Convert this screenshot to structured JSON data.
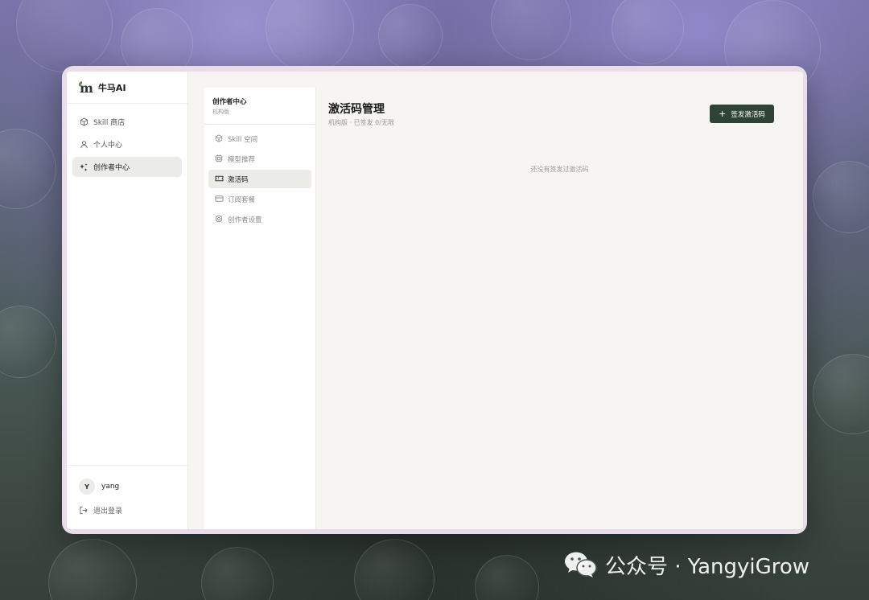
{
  "brand": {
    "name": "牛马AI"
  },
  "sidebar": {
    "items": [
      {
        "label": "Skill 商店",
        "icon": "cube-icon",
        "active": false
      },
      {
        "label": "个人中心",
        "icon": "user-icon",
        "active": false
      },
      {
        "label": "创作者中心",
        "icon": "sparkles-icon",
        "active": true
      }
    ],
    "user": {
      "avatar_letter": "Y",
      "name": "yang"
    },
    "logout_label": "退出登录"
  },
  "subnav": {
    "title": "创作者中心",
    "subtitle": "机构版",
    "items": [
      {
        "label": "Skill 空间",
        "icon": "cube-icon",
        "active": false
      },
      {
        "label": "模型推荐",
        "icon": "chip-icon",
        "active": false
      },
      {
        "label": "激活码",
        "icon": "ticket-icon",
        "active": true
      },
      {
        "label": "订阅套餐",
        "icon": "card-icon",
        "active": false
      },
      {
        "label": "创作者设置",
        "icon": "gear-icon",
        "active": false
      }
    ]
  },
  "main": {
    "title": "激活码管理",
    "subtitle": "机构版 · 已签发 0/无限",
    "issue_button": {
      "icon": "plus-icon",
      "label": "签发激活码"
    },
    "empty_text": "还没有签发过激活码"
  },
  "watermark": {
    "icon": "wechat-icon",
    "text": "公众号 · YangyiGrow"
  },
  "colors": {
    "accent": "#2e4236",
    "active_bg": "#ebece8",
    "content_bg": "#f6f5f1"
  }
}
